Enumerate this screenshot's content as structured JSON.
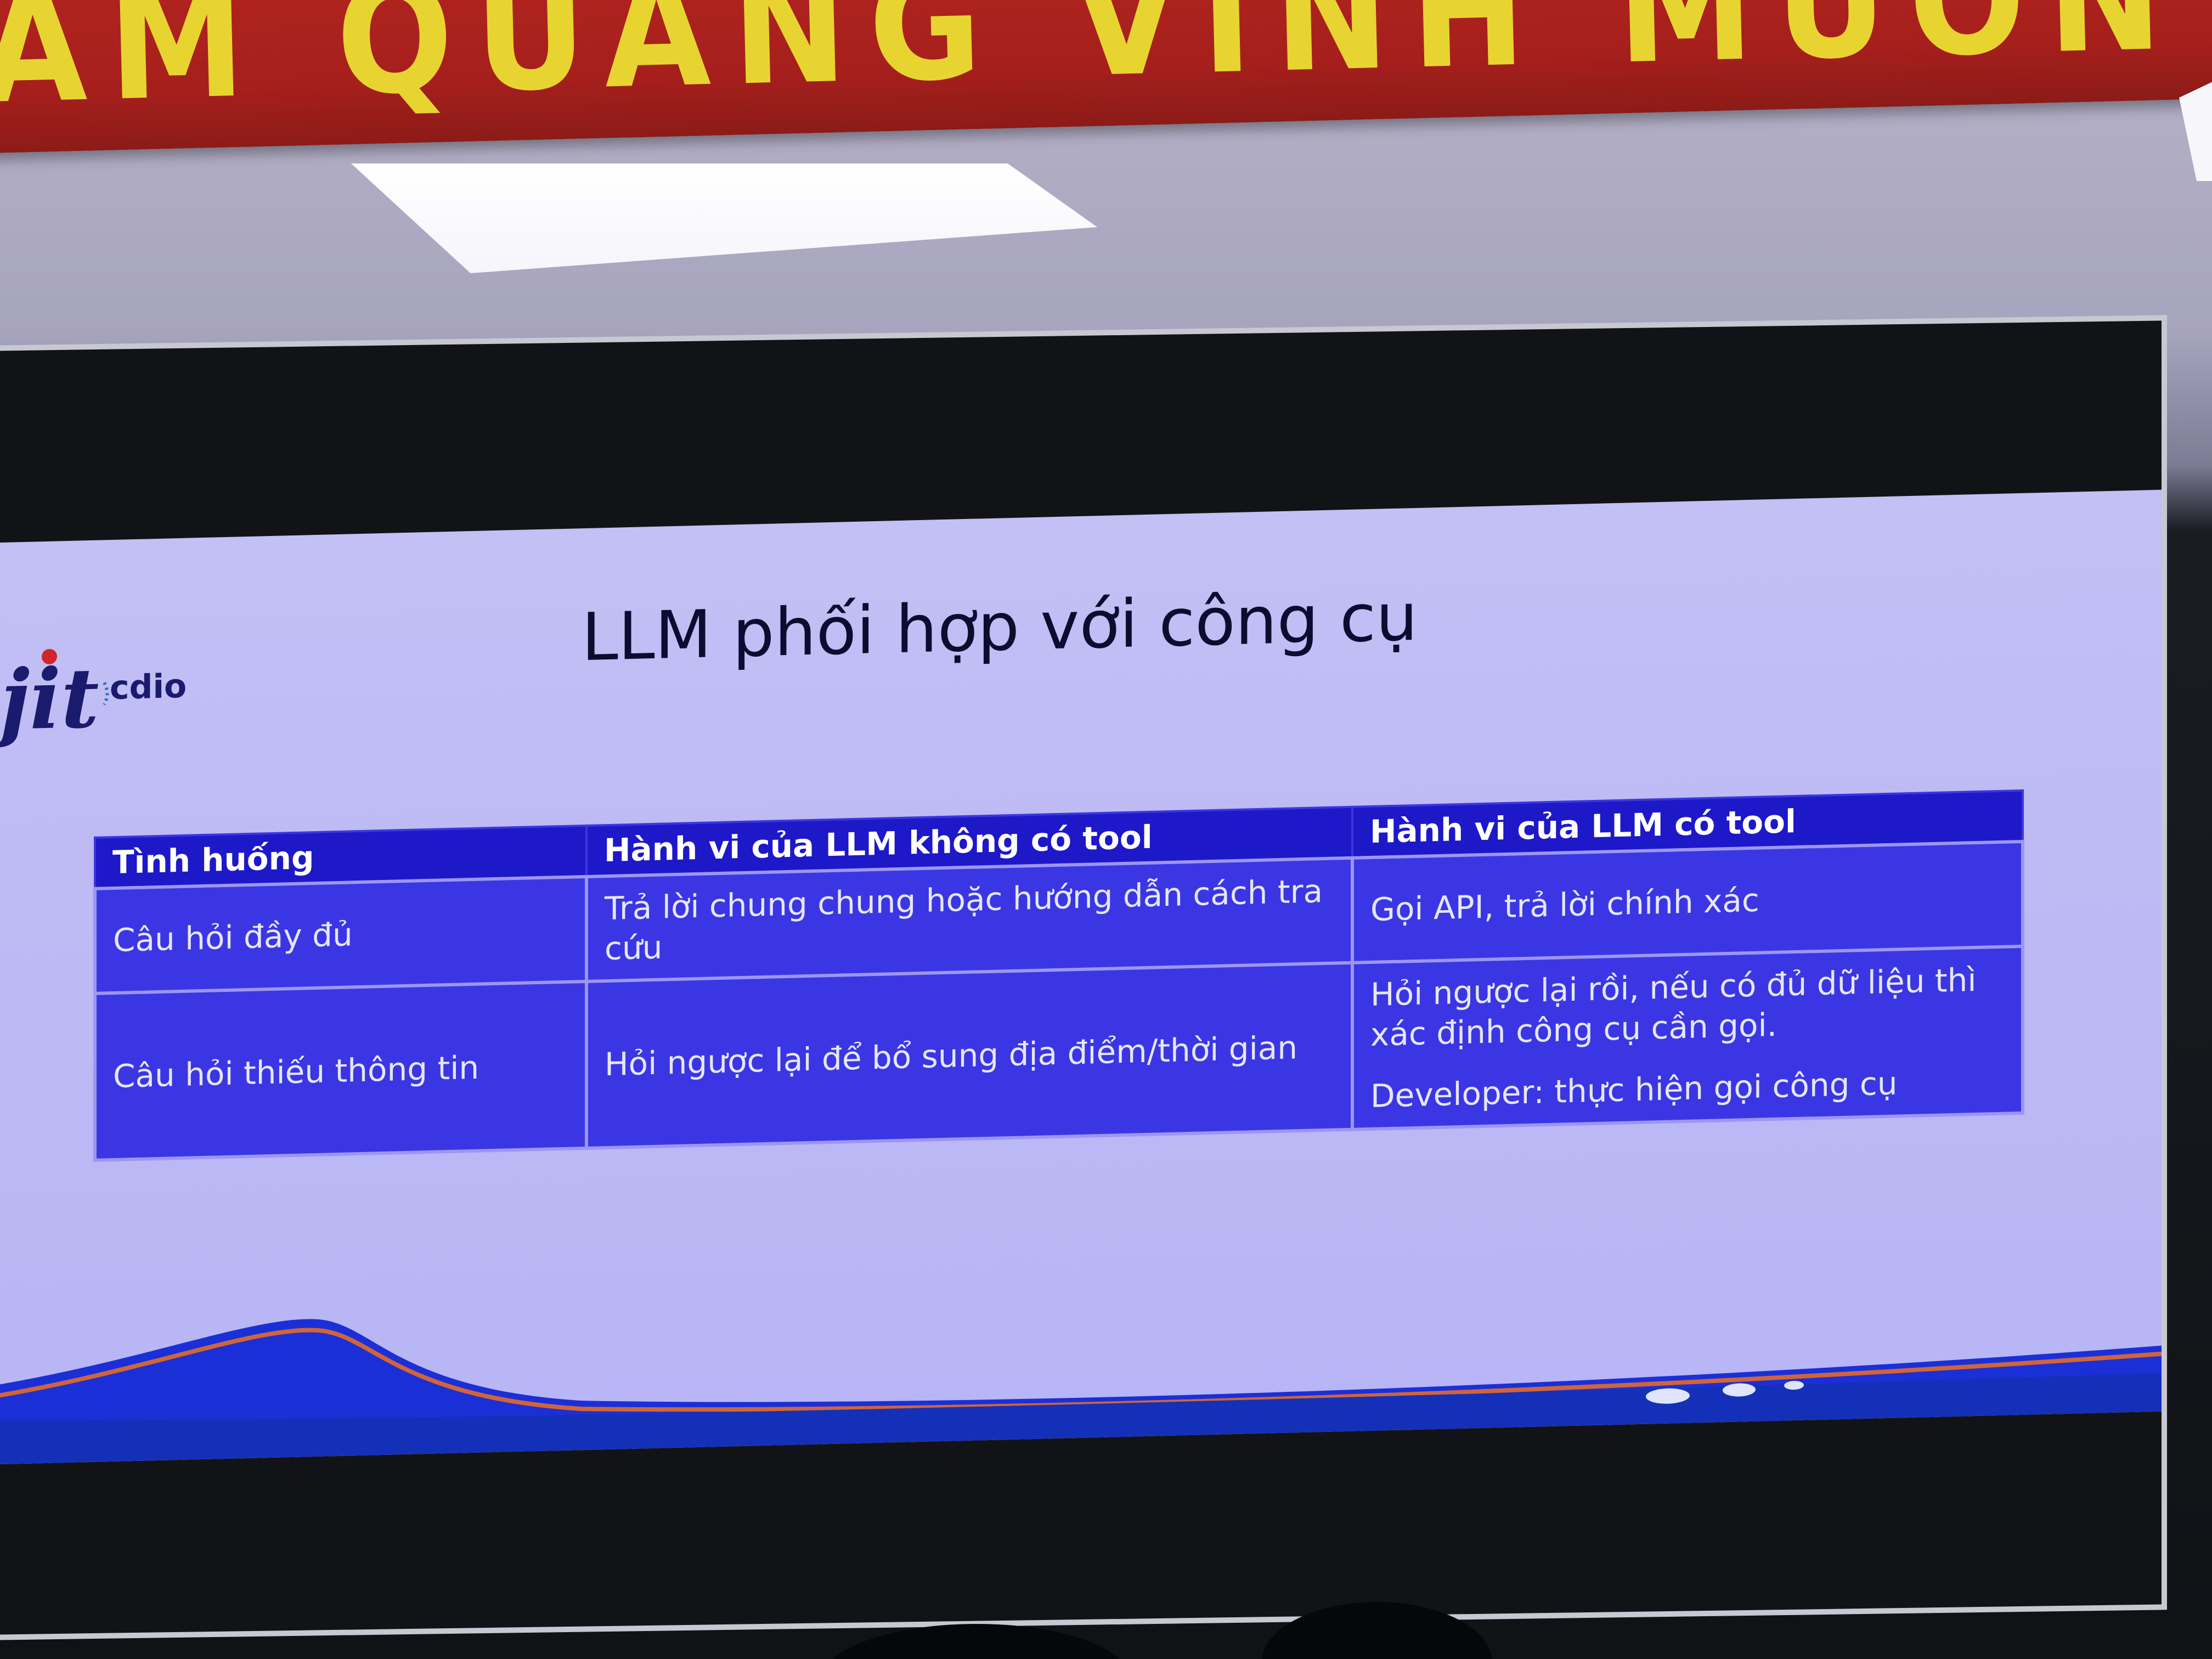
{
  "banner": {
    "text": "AM QUANG VINH MUON"
  },
  "slide": {
    "title": "LLM phối hợp với công cụ",
    "logo_text": "jit",
    "logo_sub": "cdio",
    "table": {
      "headers": [
        "Tình huống",
        "Hành vi của LLM không có tool",
        "Hành vi của LLM có tool"
      ],
      "rows": [
        {
          "situation": "Câu hỏi đầy đủ",
          "without_tool": "Trả lời chung chung hoặc hướng dẫn cách tra cứu",
          "with_tool_1": "Gọi API, trả lời chính xác",
          "with_tool_2": ""
        },
        {
          "situation": "Câu hỏi thiếu thông tin",
          "without_tool": "Hỏi ngược lại để bổ sung địa điểm/thời gian",
          "with_tool_1": "Hỏi ngược lại rồi, nếu có đủ dữ liệu thì xác định công cụ cần gọi.",
          "with_tool_2": "Developer: thực hiện gọi công cụ"
        }
      ]
    }
  },
  "colors": {
    "banner_red": "#a61f1c",
    "banner_text_yellow": "#e8d431",
    "slide_background": "#bdbaf4",
    "table_header_blue": "#1d18c8",
    "table_cell_blue": "#3b36e3"
  }
}
